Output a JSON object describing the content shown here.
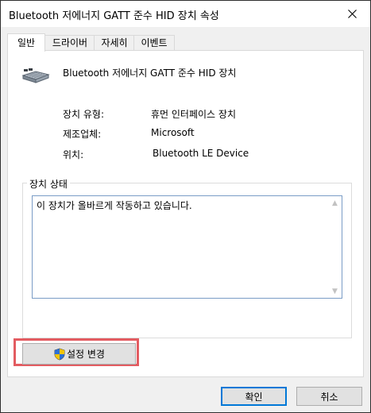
{
  "window": {
    "title": "Bluetooth 저에너지 GATT 준수 HID 장치 속성"
  },
  "tabs": [
    {
      "label": "일반",
      "active": true
    },
    {
      "label": "드라이버",
      "active": false
    },
    {
      "label": "자세히",
      "active": false
    },
    {
      "label": "이벤트",
      "active": false
    }
  ],
  "general": {
    "device_name": "Bluetooth 저에너지 GATT 준수 HID 장치",
    "device_icon": "hid-device-icon",
    "properties": [
      {
        "label": "장치 유형:",
        "value": "휴먼 인터페이스 장치"
      },
      {
        "label": "제조업체:",
        "value": "Microsoft"
      },
      {
        "label": "위치:",
        "value": "Bluetooth LE Device"
      }
    ],
    "status": {
      "group_title": "장치 상태",
      "text": "이 장치가 올바르게 작동하고 있습니다."
    },
    "change_settings_label": "설정 변경",
    "change_settings_icon": "uac-shield-icon"
  },
  "buttons": {
    "ok": "확인",
    "cancel": "취소"
  },
  "colors": {
    "highlight": "#e35c61",
    "default_button_border": "#0078d7",
    "status_border": "#7a9cc6"
  }
}
